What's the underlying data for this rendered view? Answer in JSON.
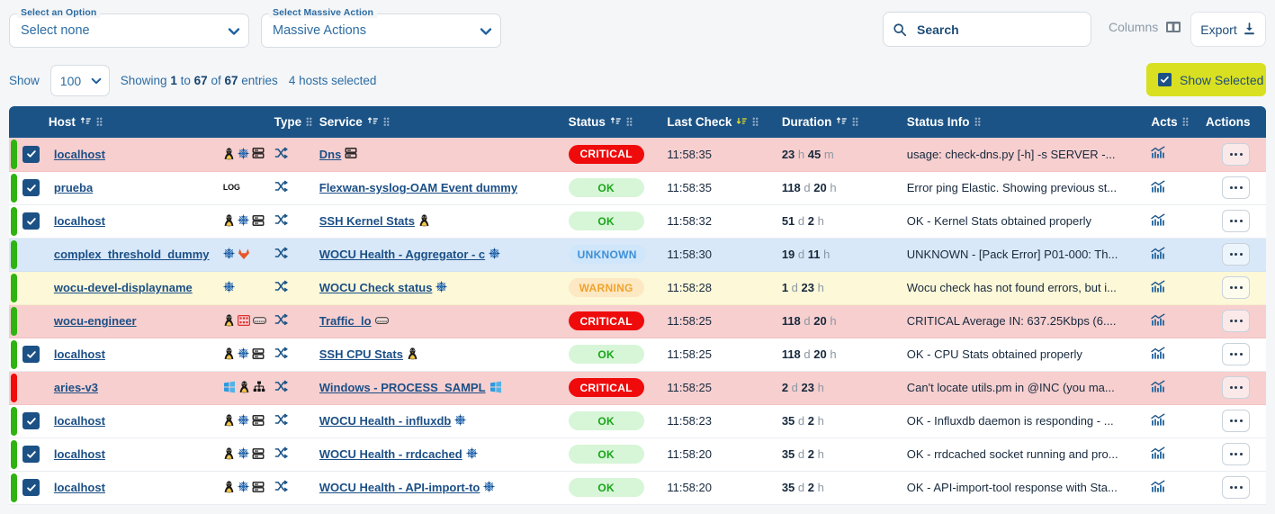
{
  "toolbar": {
    "select_option": {
      "legend": "Select an Option",
      "value": "Select none"
    },
    "massive_action": {
      "legend": "Select Massive Action",
      "value": "Massive Actions"
    },
    "search": {
      "placeholder": "Search",
      "value": ""
    },
    "columns_label": "Columns",
    "export_label": "Export",
    "show_label": "Show",
    "page_size": "100",
    "showing_prefix": "Showing",
    "showing_from": "1",
    "showing_mid": "to",
    "showing_to": "67",
    "showing_of": "of",
    "showing_total": "67",
    "showing_suffix": "entries",
    "hosts_selected": "4 hosts selected",
    "show_selected_label": "Show Selected"
  },
  "colors": {
    "header_bg": "#1b5386",
    "accent_yellow": "#d9e021",
    "critical": "#ef0b0b",
    "ok": "#1aa61a",
    "unknown": "#3d8fd6",
    "warning": "#f0a32a",
    "bar_green": "#2fb312",
    "bar_red": "#f00c0c",
    "row_critical": "#f7cfcf",
    "row_unknown": "#d8e8f8",
    "row_warning": "#fcf8d8"
  },
  "table": {
    "columns": [
      {
        "label": "Host",
        "sortable": true,
        "sorted": false
      },
      {
        "label": "Type",
        "sortable": false,
        "sorted": false
      },
      {
        "label": "Service",
        "sortable": true,
        "sorted": false
      },
      {
        "label": "Status",
        "sortable": true,
        "sorted": false
      },
      {
        "label": "Last Check",
        "sortable": true,
        "sorted": true,
        "sort_dir": "desc"
      },
      {
        "label": "Duration",
        "sortable": true,
        "sorted": false
      },
      {
        "label": "Status Info",
        "sortable": false,
        "sorted": false
      },
      {
        "label": "Acts",
        "sortable": false,
        "sorted": false
      },
      {
        "label": "Actions",
        "sortable": false,
        "sorted": false
      }
    ],
    "rows": [
      {
        "checked": true,
        "bar": "green",
        "row_state": "crit",
        "host": "localhost",
        "host_icons": [
          "linux-penguin-icon",
          "snowflake-icon",
          "server-icon"
        ],
        "type_icons": [
          "shuffle-icon"
        ],
        "service": "Dns",
        "service_icons": [
          "server-icon"
        ],
        "status": "CRITICAL",
        "last_check": "11:58:35",
        "duration_num1": "23",
        "duration_unit1": "h",
        "duration_num2": "45",
        "duration_unit2": "m",
        "status_info": "usage: check-dns.py [-h] -s SERVER -..."
      },
      {
        "checked": true,
        "bar": "green",
        "row_state": "ok",
        "host": "prueba",
        "host_icons": [
          "log-icon"
        ],
        "type_icons": [
          "shuffle-icon"
        ],
        "service": "Flexwan-syslog-OAM Event dummy",
        "service_icons": [],
        "status": "OK",
        "last_check": "11:58:35",
        "duration_num1": "118",
        "duration_unit1": "d",
        "duration_num2": "20",
        "duration_unit2": "h",
        "status_info": "Error ping Elastic. Showing previous st..."
      },
      {
        "checked": true,
        "bar": "green",
        "row_state": "ok",
        "host": "localhost",
        "host_icons": [
          "linux-penguin-icon",
          "snowflake-icon",
          "server-icon"
        ],
        "type_icons": [
          "shuffle-icon"
        ],
        "service": "SSH Kernel Stats",
        "service_icons": [
          "linux-penguin-icon"
        ],
        "status": "OK",
        "last_check": "11:58:32",
        "duration_num1": "51",
        "duration_unit1": "d",
        "duration_num2": "2",
        "duration_unit2": "h",
        "status_info": "OK - Kernel Stats obtained properly"
      },
      {
        "checked": false,
        "bar": "green",
        "row_state": "unk",
        "host": "complex_threshold_dummy",
        "host_icons": [
          "snowflake-icon",
          "gitlab-fox-icon"
        ],
        "type_icons": [
          "shuffle-icon"
        ],
        "service": "WOCU Health - Aggregator - c",
        "service_icons": [
          "snowflake-icon"
        ],
        "status": "UNKNOWN",
        "last_check": "11:58:30",
        "duration_num1": "19",
        "duration_unit1": "d",
        "duration_num2": "11",
        "duration_unit2": "h",
        "status_info": "UNKNOWN - [Pack Error] P01-000: Th..."
      },
      {
        "checked": false,
        "bar": "green",
        "row_state": "warn",
        "host": "wocu-devel-displayname",
        "host_icons": [
          "snowflake-icon"
        ],
        "type_icons": [
          "shuffle-icon"
        ],
        "service": "WOCU Check status",
        "service_icons": [
          "snowflake-icon"
        ],
        "status": "WARNING",
        "last_check": "11:58:28",
        "duration_num1": "1",
        "duration_unit1": "d",
        "duration_num2": "23",
        "duration_unit2": "h",
        "status_info": "Wocu check has not found errors, but i..."
      },
      {
        "checked": false,
        "bar": "green",
        "row_state": "crit",
        "host": "wocu-engineer",
        "host_icons": [
          "linux-penguin-icon",
          "grid-red-icon",
          "router-icon"
        ],
        "type_icons": [
          "shuffle-icon"
        ],
        "service": "Traffic_lo",
        "service_icons": [
          "router-icon"
        ],
        "status": "CRITICAL",
        "last_check": "11:58:25",
        "duration_num1": "118",
        "duration_unit1": "d",
        "duration_num2": "20",
        "duration_unit2": "h",
        "status_info": "CRITICAL Average IN: 637.25Kbps (6...."
      },
      {
        "checked": true,
        "bar": "green",
        "row_state": "ok",
        "host": "localhost",
        "host_icons": [
          "linux-penguin-icon",
          "snowflake-icon",
          "server-icon"
        ],
        "type_icons": [
          "shuffle-icon"
        ],
        "service": "SSH CPU Stats",
        "service_icons": [
          "linux-penguin-icon"
        ],
        "status": "OK",
        "last_check": "11:58:25",
        "duration_num1": "118",
        "duration_unit1": "d",
        "duration_num2": "20",
        "duration_unit2": "h",
        "status_info": "OK - CPU Stats obtained properly"
      },
      {
        "checked": false,
        "bar": "red",
        "row_state": "crit",
        "host": "aries-v3",
        "host_icons": [
          "windows-icon",
          "linux-penguin-icon",
          "network-icon"
        ],
        "type_icons": [
          "shuffle-icon"
        ],
        "service": "Windows - PROCESS_SAMPL",
        "service_icons": [
          "windows-icon"
        ],
        "status": "CRITICAL",
        "last_check": "11:58:25",
        "duration_num1": "2",
        "duration_unit1": "d",
        "duration_num2": "23",
        "duration_unit2": "h",
        "status_info": "Can't locate utils.pm in @INC (you ma..."
      },
      {
        "checked": true,
        "bar": "green",
        "row_state": "ok",
        "host": "localhost",
        "host_icons": [
          "linux-penguin-icon",
          "snowflake-icon",
          "server-icon"
        ],
        "type_icons": [
          "shuffle-icon"
        ],
        "service": "WOCU Health - influxdb",
        "service_icons": [
          "snowflake-icon"
        ],
        "status": "OK",
        "last_check": "11:58:23",
        "duration_num1": "35",
        "duration_unit1": "d",
        "duration_num2": "2",
        "duration_unit2": "h",
        "status_info": "OK - Influxdb daemon is responding - ..."
      },
      {
        "checked": true,
        "bar": "green",
        "row_state": "ok",
        "host": "localhost",
        "host_icons": [
          "linux-penguin-icon",
          "snowflake-icon",
          "server-icon"
        ],
        "type_icons": [
          "shuffle-icon"
        ],
        "service": "WOCU Health - rrdcached",
        "service_icons": [
          "snowflake-icon"
        ],
        "status": "OK",
        "last_check": "11:58:20",
        "duration_num1": "35",
        "duration_unit1": "d",
        "duration_num2": "2",
        "duration_unit2": "h",
        "status_info": "OK - rrdcached socket running and pro..."
      },
      {
        "checked": true,
        "bar": "green",
        "row_state": "ok",
        "host": "localhost",
        "host_icons": [
          "linux-penguin-icon",
          "snowflake-icon",
          "server-icon"
        ],
        "type_icons": [
          "shuffle-icon"
        ],
        "service": "WOCU Health - API-import-to",
        "service_icons": [
          "snowflake-icon"
        ],
        "status": "OK",
        "last_check": "11:58:20",
        "duration_num1": "35",
        "duration_unit1": "d",
        "duration_num2": "2",
        "duration_unit2": "h",
        "status_info": "OK - API-import-tool response with Sta..."
      }
    ]
  }
}
